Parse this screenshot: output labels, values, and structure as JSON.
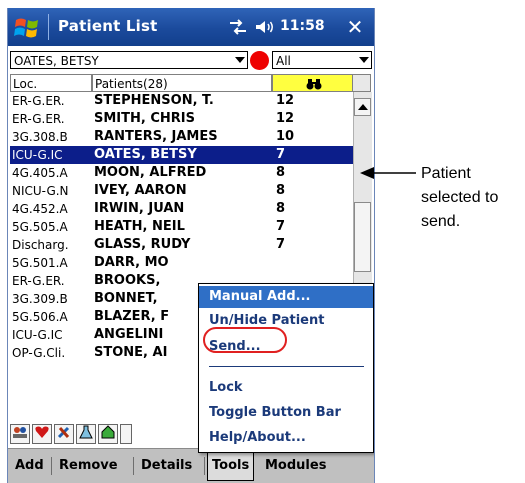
{
  "titlebar": {
    "title": "Patient List",
    "time": "11:58",
    "close": "✕"
  },
  "selector": {
    "patient": "OATES, BETSY",
    "filter": "All"
  },
  "columns": {
    "loc": "Loc.",
    "patients": "Patients(28)"
  },
  "rows": [
    {
      "loc": "ER-G.ER.",
      "name": "STEPHENSON, T.",
      "count": "12"
    },
    {
      "loc": "ER-G.ER.",
      "name": "SMITH, CHRIS",
      "count": "12"
    },
    {
      "loc": "3G.308.B",
      "name": "RANTERS, JAMES",
      "count": "10"
    },
    {
      "loc": "ICU-G.IC",
      "name": "OATES, BETSY",
      "count": "7",
      "selected": true
    },
    {
      "loc": "4G.405.A",
      "name": "MOON, ALFRED",
      "count": "8"
    },
    {
      "loc": "NICU-G.N",
      "name": "IVEY, AARON",
      "count": "8"
    },
    {
      "loc": "4G.452.A",
      "name": "IRWIN, JUAN",
      "count": "8"
    },
    {
      "loc": "5G.505.A",
      "name": "HEATH, NEIL",
      "count": "7"
    },
    {
      "loc": "Discharg.",
      "name": "GLASS, RUDY",
      "count": "7"
    },
    {
      "loc": "5G.501.A",
      "name": "DARR, MO",
      "count": ""
    },
    {
      "loc": "ER-G.ER.",
      "name": "BROOKS,",
      "count": ""
    },
    {
      "loc": "3G.309.B",
      "name": "BONNET,",
      "count": ""
    },
    {
      "loc": "5G.506.A",
      "name": "BLAZER, F",
      "count": ""
    },
    {
      "loc": "ICU-G.IC",
      "name": "ANGELINI",
      "count": ""
    },
    {
      "loc": "OP-G.Cli.",
      "name": "STONE, AI",
      "count": ""
    }
  ],
  "menu": {
    "manual_add": "Manual Add...",
    "unhide": "Un/Hide Patient",
    "send": "Send...",
    "lock": "Lock",
    "toggle": "Toggle Button Bar",
    "help": "Help/About..."
  },
  "tabs": {
    "add": "Add",
    "remove": "Remove",
    "details": "Details",
    "tools": "Tools",
    "modules": "Modules"
  },
  "callout": {
    "line1": "Patient",
    "line2": "selected to",
    "line3": "send."
  },
  "colors": {
    "titlebar": "#1b4a9c",
    "selected_row": "#0c1e8a",
    "menu_highlight": "#2f6fc6",
    "highlight_oval": "#e02020",
    "tool_header": "#ffff40"
  },
  "icons": [
    "windows-start-icon",
    "connectivity-icon",
    "volume-icon",
    "binoculars-icon",
    "patients-icon",
    "heart-icon",
    "tools-icon",
    "flask-icon",
    "home-icon"
  ]
}
